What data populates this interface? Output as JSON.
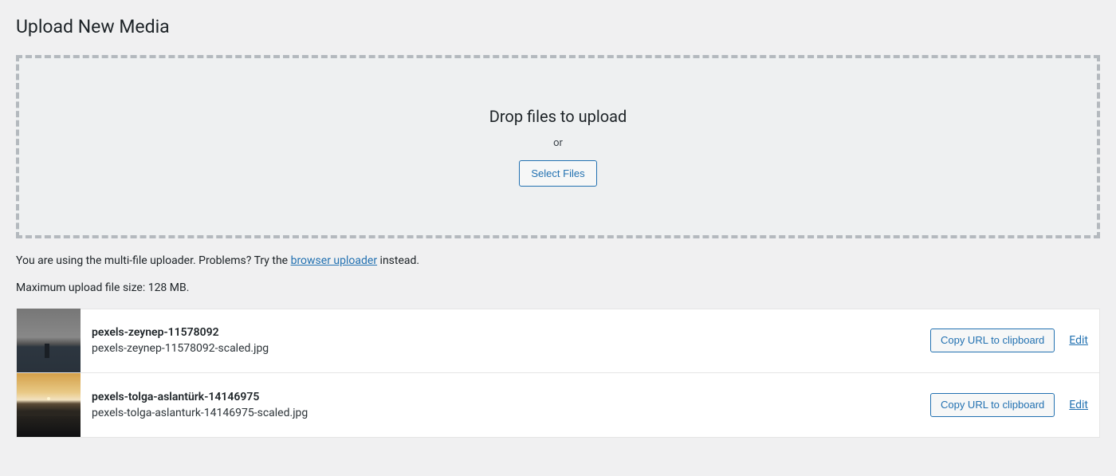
{
  "page_title": "Upload New Media",
  "dropzone": {
    "drop_text": "Drop files to upload",
    "or_text": "or",
    "select_button": "Select Files"
  },
  "uploader_info": {
    "prefix": "You are using the multi-file uploader. Problems? Try the ",
    "link_text": "browser uploader",
    "suffix": " instead."
  },
  "max_size_text": "Maximum upload file size: 128 MB.",
  "actions": {
    "copy_label": "Copy URL to clipboard",
    "edit_label": "Edit"
  },
  "media_items": [
    {
      "title": "pexels-zeynep-11578092",
      "filename": "pexels-zeynep-11578092-scaled.jpg",
      "thumb_style": "city"
    },
    {
      "title": "pexels-tolga-aslantürk-14146975",
      "filename": "pexels-tolga-aslanturk-14146975-scaled.jpg",
      "thumb_style": "sunset"
    }
  ]
}
